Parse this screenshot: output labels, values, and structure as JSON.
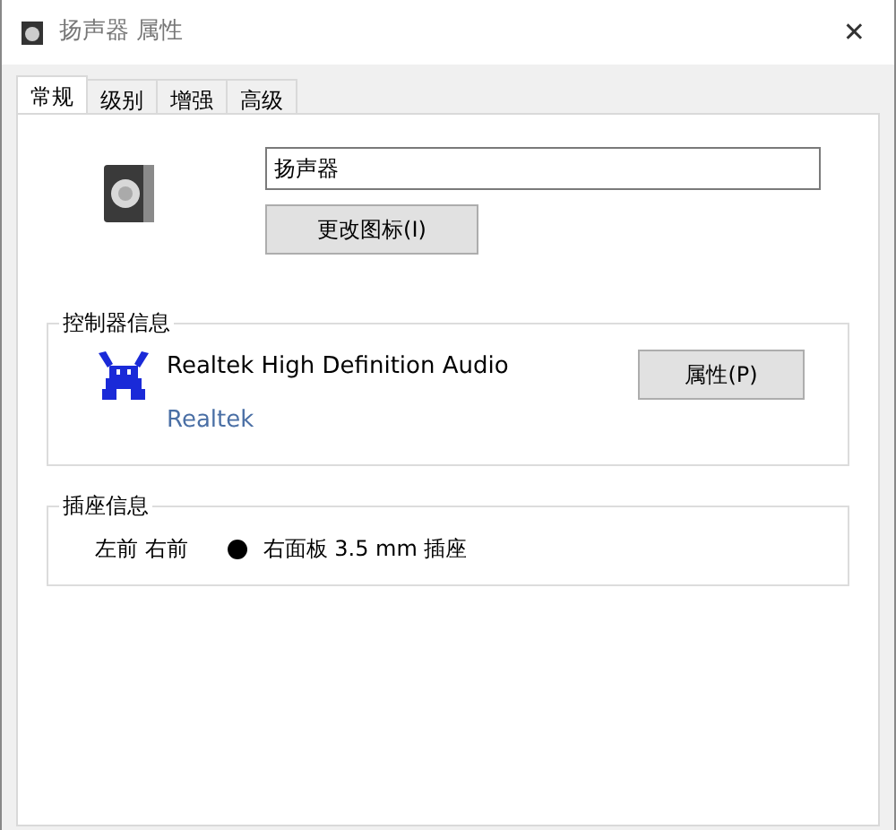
{
  "window": {
    "title": "扬声器 属性",
    "close": "✕"
  },
  "tabs": [
    {
      "label": "常规",
      "selected": true
    },
    {
      "label": "级别",
      "selected": false
    },
    {
      "label": "增强",
      "selected": false
    },
    {
      "label": "高级",
      "selected": false
    }
  ],
  "device": {
    "name": "扬声器",
    "change_icon_button": "更改图标(I)"
  },
  "controller": {
    "legend": "控制器信息",
    "name": "Realtek High Definition Audio",
    "link": "Realtek",
    "button": "属性(P)"
  },
  "jack": {
    "legend": "插座信息",
    "channels": "左前 右前",
    "color": "#000000",
    "description": "右面板 3.5 mm 插座"
  }
}
